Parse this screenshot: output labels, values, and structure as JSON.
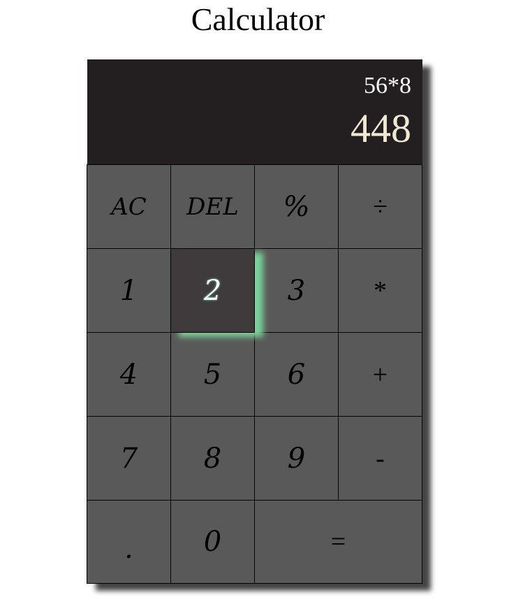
{
  "page": {
    "title": "Calculator"
  },
  "display": {
    "previous_operand": "56*8",
    "current_operand": "448"
  },
  "keys": {
    "ac": "AC",
    "del": "DEL",
    "percent": "%",
    "divide": "÷",
    "one": "1",
    "two": "2",
    "three": "3",
    "multiply": "*",
    "four": "4",
    "five": "5",
    "six": "6",
    "plus": "+",
    "seven": "7",
    "eight": "8",
    "nine": "9",
    "minus": "-",
    "dot": ".",
    "zero": "0",
    "equals": "="
  },
  "state": {
    "active_key": "2"
  },
  "colors": {
    "display_bg": "#231f20",
    "key_bg": "#5a5959",
    "active_key_bg": "#3f3a3c",
    "active_glow": "#7bd19a"
  }
}
